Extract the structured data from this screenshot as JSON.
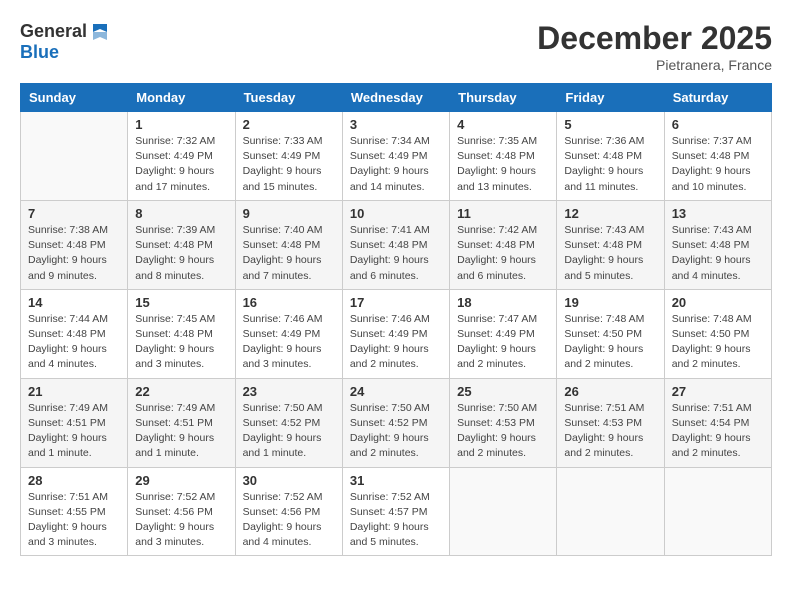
{
  "header": {
    "logo_general": "General",
    "logo_blue": "Blue",
    "month": "December 2025",
    "location": "Pietranera, France"
  },
  "days_of_week": [
    "Sunday",
    "Monday",
    "Tuesday",
    "Wednesday",
    "Thursday",
    "Friday",
    "Saturday"
  ],
  "weeks": [
    {
      "days": [
        {
          "num": "",
          "empty": true
        },
        {
          "num": "1",
          "sunrise": "7:32 AM",
          "sunset": "4:49 PM",
          "daylight": "9 hours and 17 minutes."
        },
        {
          "num": "2",
          "sunrise": "7:33 AM",
          "sunset": "4:49 PM",
          "daylight": "9 hours and 15 minutes."
        },
        {
          "num": "3",
          "sunrise": "7:34 AM",
          "sunset": "4:49 PM",
          "daylight": "9 hours and 14 minutes."
        },
        {
          "num": "4",
          "sunrise": "7:35 AM",
          "sunset": "4:48 PM",
          "daylight": "9 hours and 13 minutes."
        },
        {
          "num": "5",
          "sunrise": "7:36 AM",
          "sunset": "4:48 PM",
          "daylight": "9 hours and 11 minutes."
        },
        {
          "num": "6",
          "sunrise": "7:37 AM",
          "sunset": "4:48 PM",
          "daylight": "9 hours and 10 minutes."
        }
      ]
    },
    {
      "days": [
        {
          "num": "7",
          "sunrise": "7:38 AM",
          "sunset": "4:48 PM",
          "daylight": "9 hours and 9 minutes."
        },
        {
          "num": "8",
          "sunrise": "7:39 AM",
          "sunset": "4:48 PM",
          "daylight": "9 hours and 8 minutes."
        },
        {
          "num": "9",
          "sunrise": "7:40 AM",
          "sunset": "4:48 PM",
          "daylight": "9 hours and 7 minutes."
        },
        {
          "num": "10",
          "sunrise": "7:41 AM",
          "sunset": "4:48 PM",
          "daylight": "9 hours and 6 minutes."
        },
        {
          "num": "11",
          "sunrise": "7:42 AM",
          "sunset": "4:48 PM",
          "daylight": "9 hours and 6 minutes."
        },
        {
          "num": "12",
          "sunrise": "7:43 AM",
          "sunset": "4:48 PM",
          "daylight": "9 hours and 5 minutes."
        },
        {
          "num": "13",
          "sunrise": "7:43 AM",
          "sunset": "4:48 PM",
          "daylight": "9 hours and 4 minutes."
        }
      ]
    },
    {
      "days": [
        {
          "num": "14",
          "sunrise": "7:44 AM",
          "sunset": "4:48 PM",
          "daylight": "9 hours and 4 minutes."
        },
        {
          "num": "15",
          "sunrise": "7:45 AM",
          "sunset": "4:48 PM",
          "daylight": "9 hours and 3 minutes."
        },
        {
          "num": "16",
          "sunrise": "7:46 AM",
          "sunset": "4:49 PM",
          "daylight": "9 hours and 3 minutes."
        },
        {
          "num": "17",
          "sunrise": "7:46 AM",
          "sunset": "4:49 PM",
          "daylight": "9 hours and 2 minutes."
        },
        {
          "num": "18",
          "sunrise": "7:47 AM",
          "sunset": "4:49 PM",
          "daylight": "9 hours and 2 minutes."
        },
        {
          "num": "19",
          "sunrise": "7:48 AM",
          "sunset": "4:50 PM",
          "daylight": "9 hours and 2 minutes."
        },
        {
          "num": "20",
          "sunrise": "7:48 AM",
          "sunset": "4:50 PM",
          "daylight": "9 hours and 2 minutes."
        }
      ]
    },
    {
      "days": [
        {
          "num": "21",
          "sunrise": "7:49 AM",
          "sunset": "4:51 PM",
          "daylight": "9 hours and 1 minute."
        },
        {
          "num": "22",
          "sunrise": "7:49 AM",
          "sunset": "4:51 PM",
          "daylight": "9 hours and 1 minute."
        },
        {
          "num": "23",
          "sunrise": "7:50 AM",
          "sunset": "4:52 PM",
          "daylight": "9 hours and 1 minute."
        },
        {
          "num": "24",
          "sunrise": "7:50 AM",
          "sunset": "4:52 PM",
          "daylight": "9 hours and 2 minutes."
        },
        {
          "num": "25",
          "sunrise": "7:50 AM",
          "sunset": "4:53 PM",
          "daylight": "9 hours and 2 minutes."
        },
        {
          "num": "26",
          "sunrise": "7:51 AM",
          "sunset": "4:53 PM",
          "daylight": "9 hours and 2 minutes."
        },
        {
          "num": "27",
          "sunrise": "7:51 AM",
          "sunset": "4:54 PM",
          "daylight": "9 hours and 2 minutes."
        }
      ]
    },
    {
      "days": [
        {
          "num": "28",
          "sunrise": "7:51 AM",
          "sunset": "4:55 PM",
          "daylight": "9 hours and 3 minutes."
        },
        {
          "num": "29",
          "sunrise": "7:52 AM",
          "sunset": "4:56 PM",
          "daylight": "9 hours and 3 minutes."
        },
        {
          "num": "30",
          "sunrise": "7:52 AM",
          "sunset": "4:56 PM",
          "daylight": "9 hours and 4 minutes."
        },
        {
          "num": "31",
          "sunrise": "7:52 AM",
          "sunset": "4:57 PM",
          "daylight": "9 hours and 5 minutes."
        },
        {
          "num": "",
          "empty": true
        },
        {
          "num": "",
          "empty": true
        },
        {
          "num": "",
          "empty": true
        }
      ]
    }
  ],
  "labels": {
    "sunrise": "Sunrise:",
    "sunset": "Sunset:",
    "daylight": "Daylight:"
  }
}
